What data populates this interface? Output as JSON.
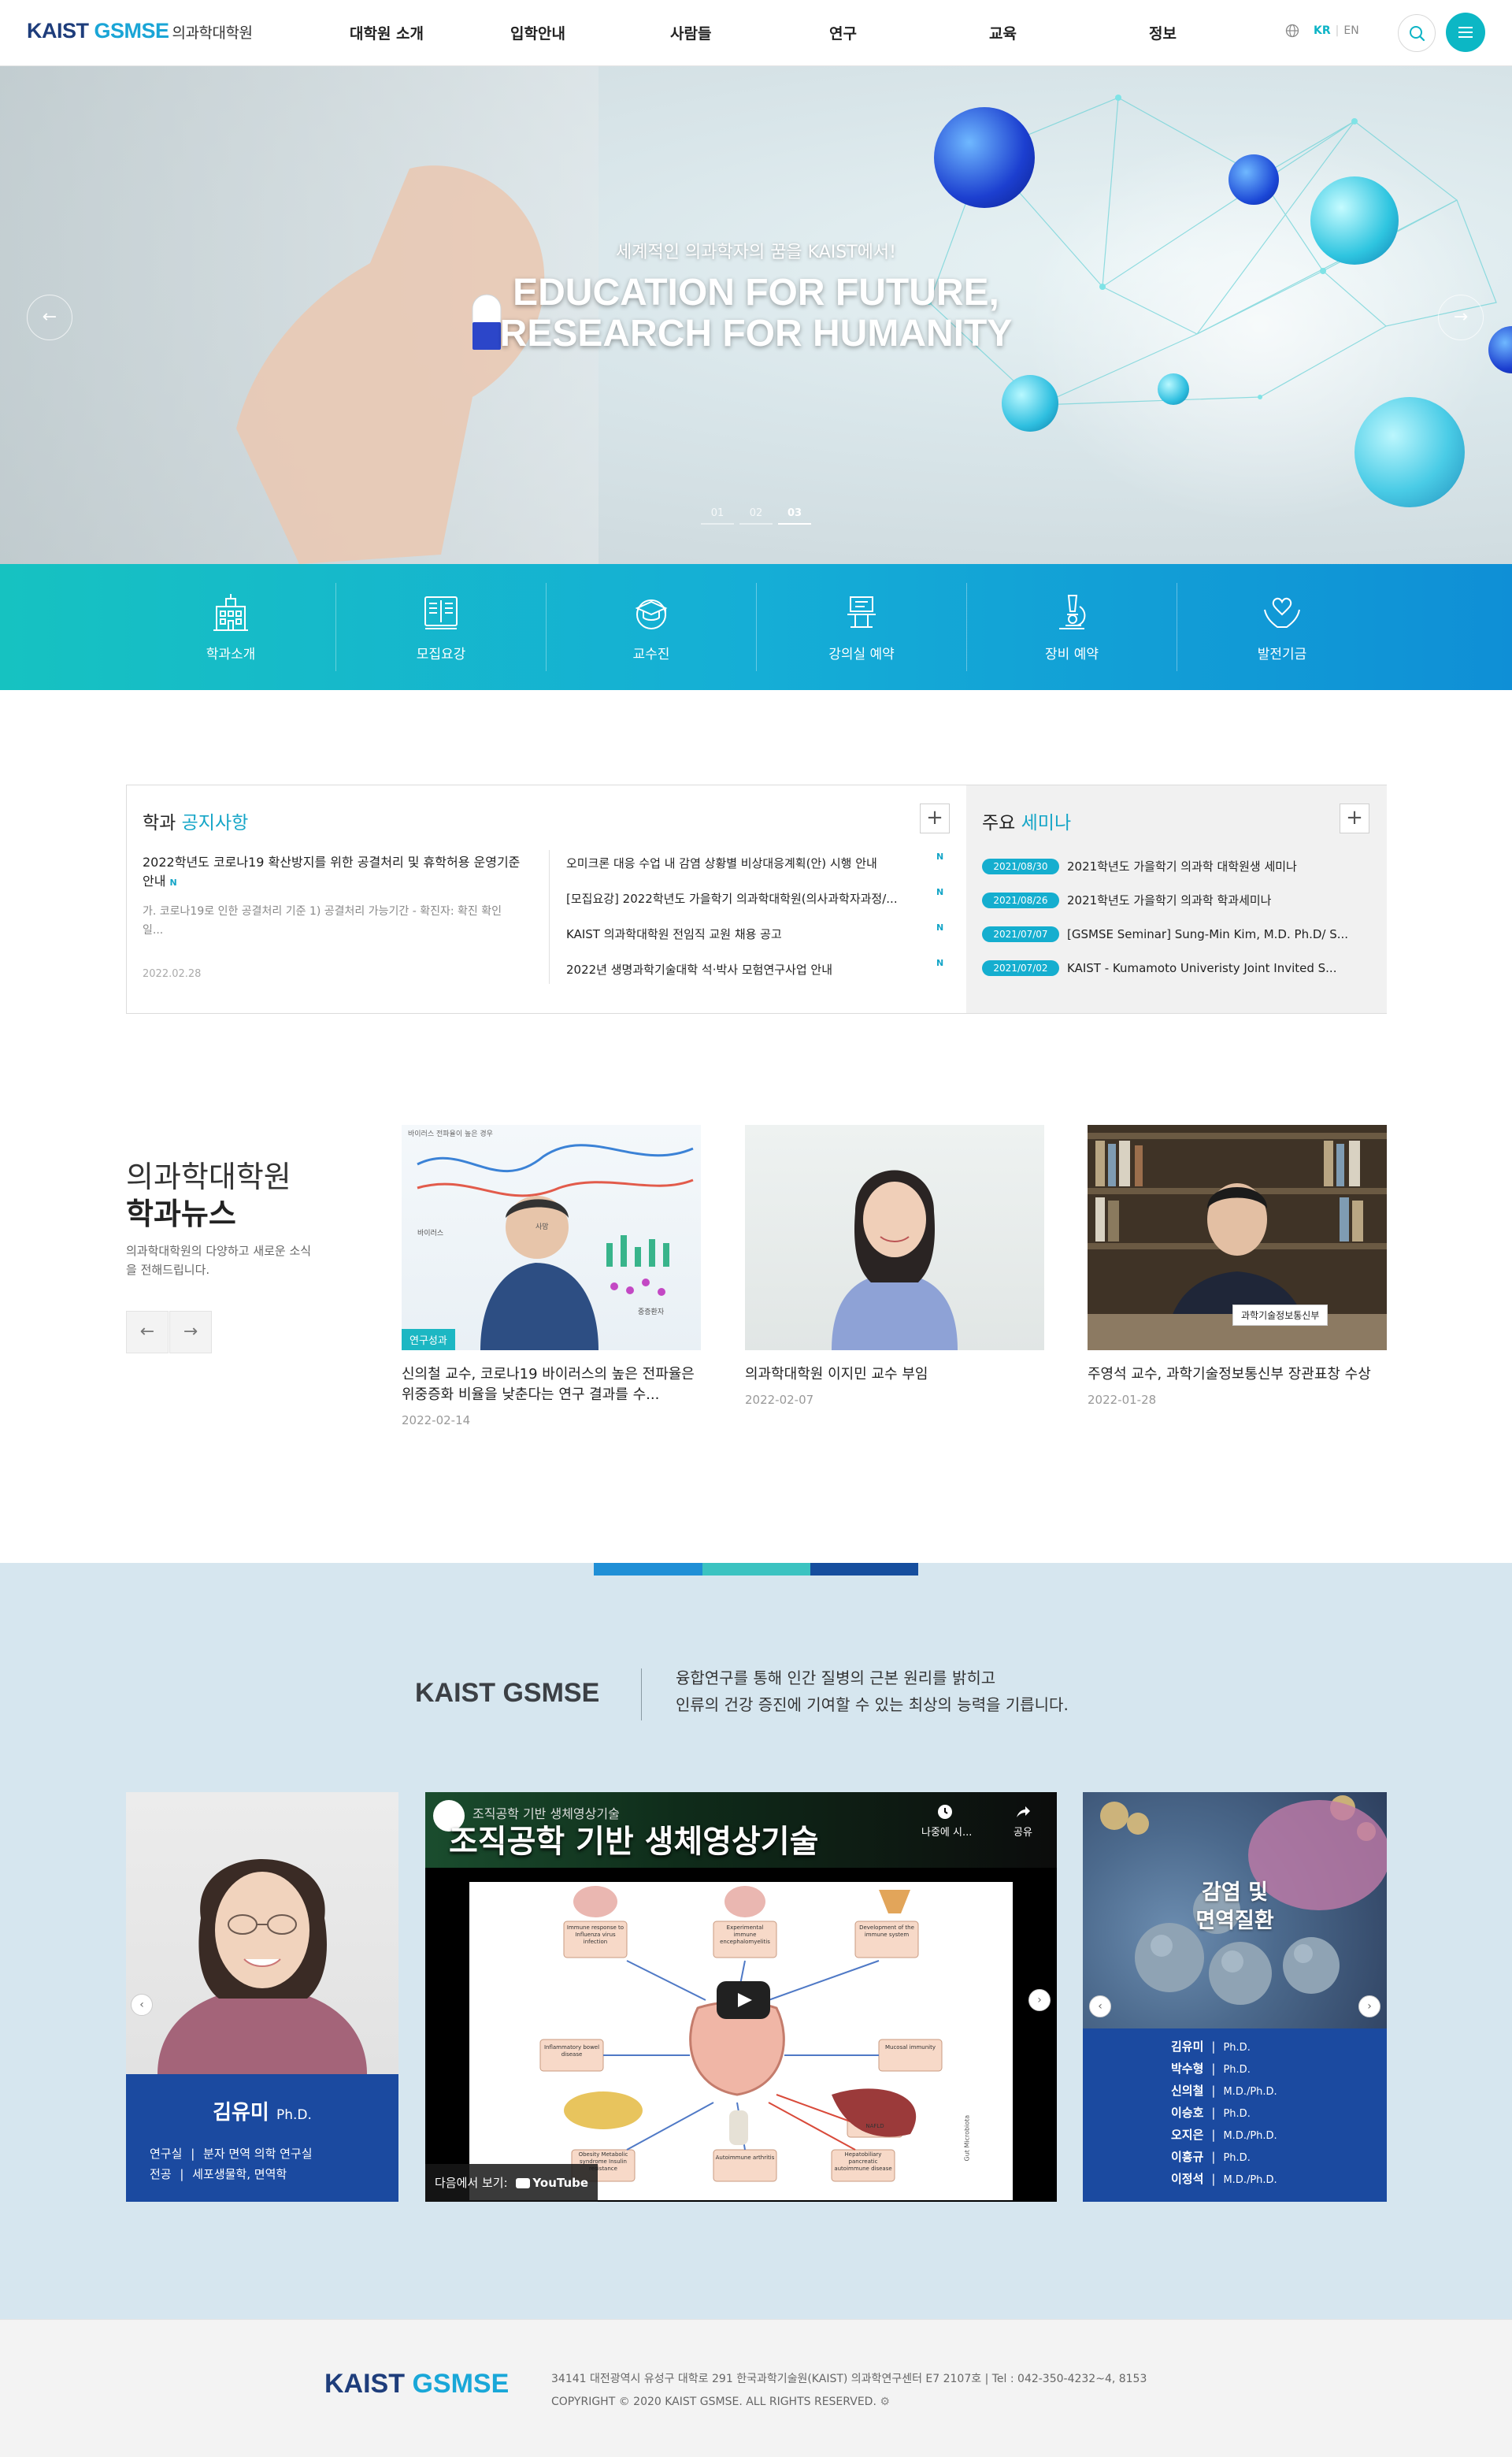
{
  "header": {
    "logo_main": "KAIST ",
    "logo_accent": "GSMSE",
    "logo_sub": "의과학대학원",
    "nav": [
      "대학원 소개",
      "입학안내",
      "사람들",
      "연구",
      "교육",
      "정보"
    ],
    "lang_kr": "KR",
    "lang_en": "EN",
    "icons": {
      "globe": "globe-icon",
      "search": "search-icon",
      "menu": "menu-icon"
    }
  },
  "hero": {
    "subtitle": "세계적인 의과학자의 꿈을 KAIST에서!",
    "title_line1": "EDUCATION FOR FUTURE,",
    "title_line2": "RESEARCH FOR HUMANITY",
    "pager": [
      "01",
      "02",
      "03"
    ],
    "active_page": "03",
    "prev": "←",
    "next": "→"
  },
  "quick_menu": [
    {
      "label": "학과소개",
      "icon": "building-icon"
    },
    {
      "label": "모집요강",
      "icon": "book-icon"
    },
    {
      "label": "교수진",
      "icon": "graduation-cap-icon"
    },
    {
      "label": "강의실 예약",
      "icon": "lectern-icon"
    },
    {
      "label": "장비 예약",
      "icon": "microscope-icon"
    },
    {
      "label": "발전기금",
      "icon": "heart-hands-icon"
    }
  ],
  "notice": {
    "title_pre": "학과",
    "title_hl": "공지사항",
    "more": "+",
    "new_badge": "N",
    "featured_title": "2022학년도 코로나19 확산방지를 위한 공결처리 및 휴학허용 운영기준 안내",
    "featured_excerpt": "가. 코로나19로 인한 공결처리 기준   1) 공결처리 가능기간     - 확진자: 확진 확인일...",
    "featured_date": "2022.02.28",
    "items": [
      "오미크론 대응 수업 내 감염 상황별 비상대응계획(안) 시행 안내",
      "[모집요강] 2022학년도 가을학기 의과학대학원(의사과학자과정/...",
      "KAIST 의과학대학원 전임직 교원 채용 공고",
      "2022년 생명과학기술대학 석·박사 모험연구사업 안내"
    ]
  },
  "seminar": {
    "title_pre": "주요",
    "title_hl": "세미나",
    "more": "+",
    "items": [
      {
        "date": "2021/08/30",
        "title": "2021학년도 가을학기 의과학 대학원생 세미나"
      },
      {
        "date": "2021/08/26",
        "title": "2021학년도 가을학기 의과학 학과세미나"
      },
      {
        "date": "2021/07/07",
        "title": "[GSMSE Seminar] Sung-Min Kim, M.D. Ph.D/ S..."
      },
      {
        "date": "2021/07/02",
        "title": "KAIST - Kumamoto Univeristy Joint Invited S..."
      }
    ]
  },
  "news": {
    "heading1": "의과학대학원",
    "heading2": "학과뉴스",
    "desc": "의과학대학원의 다양하고 새로운 소식을 전해드립니다.",
    "prev": "←",
    "next": "→",
    "cards": [
      {
        "title": "신의철 교수, 코로나19 바이러스의 높은 전파율은 위중증화 비율을 낮춘다는 연구 결과를 수...",
        "date": "2022-02-14",
        "badge": "연구성과",
        "img_caption": "바이러스 전파율이 높은 경우",
        "img_label_a": "사망",
        "img_label_b": "중증환자",
        "img_label_c": "바이러스"
      },
      {
        "title": "의과학대학원 이지민 교수 부임",
        "date": "2022-02-07"
      },
      {
        "title": "주영석 교수, 과학기술정보통신부 장관표창 수상",
        "date": "2022-01-28",
        "plaque": "과학기술정보통신부"
      }
    ]
  },
  "gsmse": {
    "logo": "KAIST GSMSE",
    "msg1": "융합연구를 통해 인간 질병의 근본 원리를 밝히고",
    "msg2": "인류의 건강 증진에 기여할 수 있는 최상의 능력을 기릅니다.",
    "bar_colors": [
      "#1f8fd6",
      "#3bc3c1",
      "#164e9e"
    ]
  },
  "professor": {
    "name": "김유미",
    "degree": "Ph.D.",
    "lab_label": "연구실",
    "lab": "분자 면역 의학 연구실",
    "major_label": "전공",
    "major": "세포생물학, 면역학",
    "sep": "|"
  },
  "video": {
    "title": "조직공학 기반 생체영상기술",
    "top_title": "조직공학 기반 생체영상기술",
    "watch_later": "나중에 시...",
    "share": "공유",
    "watch_on": "다음에서 보기:",
    "youtube": "YouTube",
    "diagram_labels": [
      "Immune response to Influenza virus infection",
      "Experimental immune encephalomyelitis",
      "Development of the immune system",
      "Inflammatory bowel disease",
      "Mucosal immunity",
      "NAFLD",
      "Obesity Metabolic syndrome Insulin resistance",
      "Autoimmune arthritis",
      "Hepatobiliary pancreatic autoimmune disease"
    ],
    "vertical_label": "Gut Microbiota"
  },
  "field": {
    "title_line1": "감염 및",
    "title_line2": "면역질환",
    "sep": "|",
    "members": [
      {
        "name": "김유미",
        "degree": "Ph.D."
      },
      {
        "name": "박수형",
        "degree": "Ph.D."
      },
      {
        "name": "신의철",
        "degree": "M.D./Ph.D."
      },
      {
        "name": "이승호",
        "degree": "Ph.D."
      },
      {
        "name": "오지은",
        "degree": "M.D./Ph.D."
      },
      {
        "name": "이흥규",
        "degree": "Ph.D."
      },
      {
        "name": "이정석",
        "degree": "M.D./Ph.D."
      }
    ]
  },
  "footer": {
    "logo_main": "KAIST ",
    "logo_accent": "GSMSE",
    "address": "34141 대전광역시 유성구 대학로 291 한국과학기술원(KAIST) 의과학연구센터 E7 2107호  |  Tel : 042-350-4232~4, 8153",
    "copyright": "COPYRIGHT © 2020 KAIST GSMSE. ALL RIGHTS RESERVED."
  }
}
